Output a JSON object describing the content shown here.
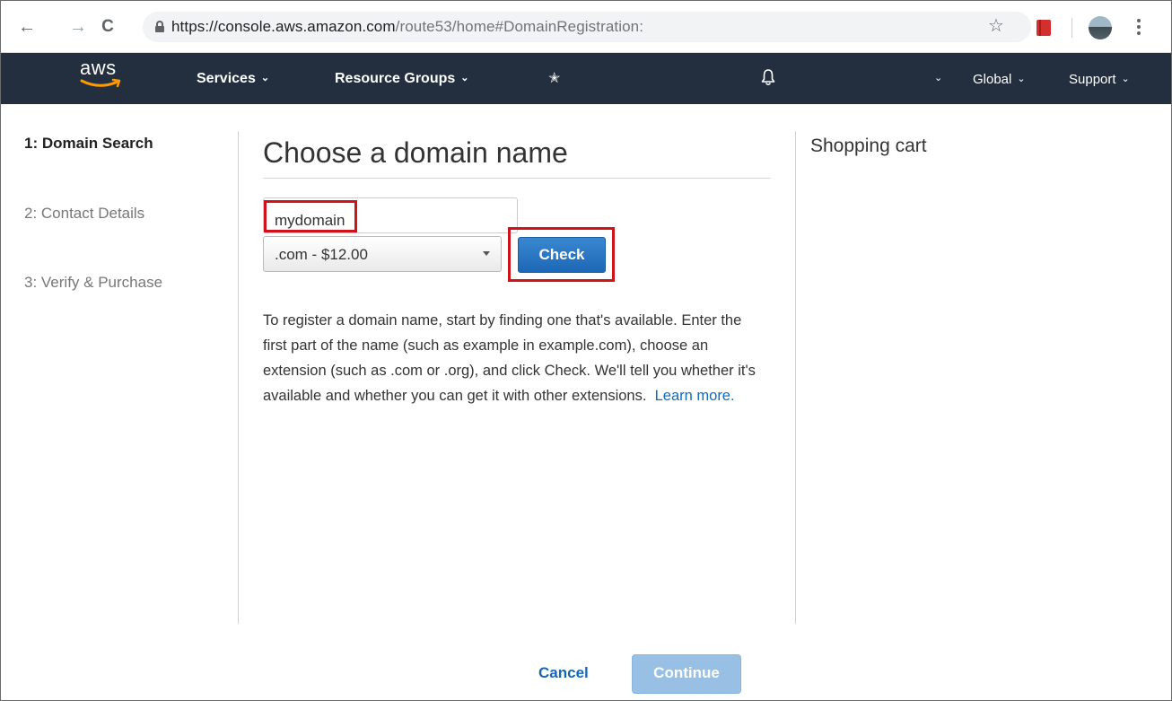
{
  "browser": {
    "url_host": "https://console.aws.amazon.com",
    "url_path": "/route53/home#DomainRegistration:",
    "back_glyph": "←",
    "forward_glyph": "→",
    "reload_glyph": "C",
    "star_glyph": "☆"
  },
  "aws_nav": {
    "logo_text": "aws",
    "services_label": "Services",
    "resource_groups_label": "Resource Groups",
    "pin_glyph": "✭",
    "region_label": "Global",
    "support_label": "Support",
    "caret_glyph": "⌄",
    "background_color": "#232f3e",
    "smile_color": "#ff9900"
  },
  "steps": [
    {
      "label": "1: Domain Search",
      "active": true
    },
    {
      "label": "2: Contact Details",
      "active": false
    },
    {
      "label": "3: Verify & Purchase",
      "active": false
    }
  ],
  "main": {
    "title": "Choose a domain name",
    "domain_input_value": "mydomain",
    "tld_selected": ".com - $12.00",
    "check_label": "Check",
    "description": "To register a domain name, start by finding one that's available. Enter the first part of the name (such as example in example.com), choose an extension (such as .com or .org), and click Check. We'll tell you whether it's available and whether you can get it with other extensions.",
    "learn_more_label": "Learn more."
  },
  "cart": {
    "title": "Shopping cart"
  },
  "footer": {
    "cancel_label": "Cancel",
    "continue_label": "Continue"
  },
  "colors": {
    "primary_button": "#1d68b6",
    "disabled_button": "#98c0e5",
    "link": "#0d6cbf",
    "highlight_red": "#d0121b"
  },
  "icons": {
    "back": "back-arrow-icon",
    "forward": "forward-arrow-icon",
    "reload": "reload-icon",
    "lock": "lock-icon",
    "bookmark": "bookmark-star-icon",
    "extension": "red-book-extension-icon",
    "profile": "profile-avatar-icon",
    "menu": "kebab-menu-icon",
    "pin": "pin-icon",
    "notifications": "bell-icon"
  }
}
